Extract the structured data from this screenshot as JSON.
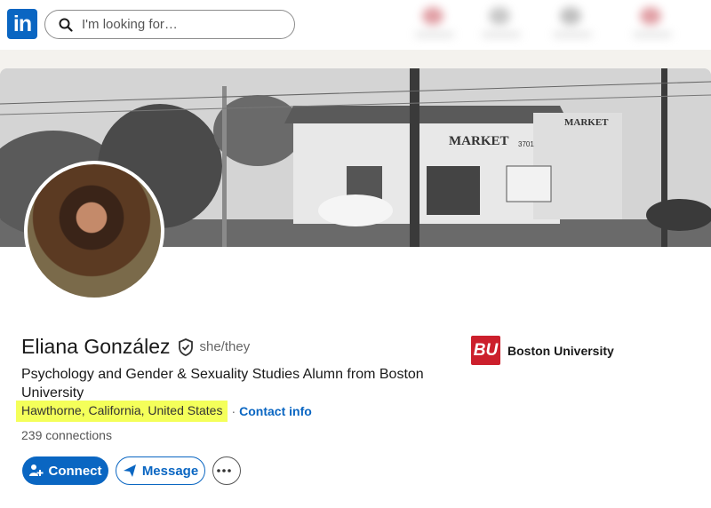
{
  "nav": {
    "logo_text": "in",
    "search_placeholder": "I'm looking for…"
  },
  "profile": {
    "name": "Eliana González",
    "pronouns": "she/they",
    "headline": "Psychology and Gender & Sexuality Studies Alumn from Boston University",
    "location": "Hawthorne, California, United States",
    "separator": "·",
    "contact_info_label": "Contact info",
    "connections": "239 connections"
  },
  "actions": {
    "connect_label": "Connect",
    "message_label": "Message"
  },
  "education": {
    "logo_text": "BU",
    "school_name": "Boston University"
  },
  "banner": {
    "signs": [
      "MARKET",
      "MARKET",
      "3701"
    ]
  },
  "colors": {
    "brand_blue": "#0a66c2",
    "location_highlight": "#f4ff5a",
    "bu_red": "#cc1f2c"
  },
  "icons": [
    "linkedin-logo",
    "search-icon",
    "verified-shield-icon",
    "add-person-icon",
    "send-icon",
    "more-icon"
  ]
}
